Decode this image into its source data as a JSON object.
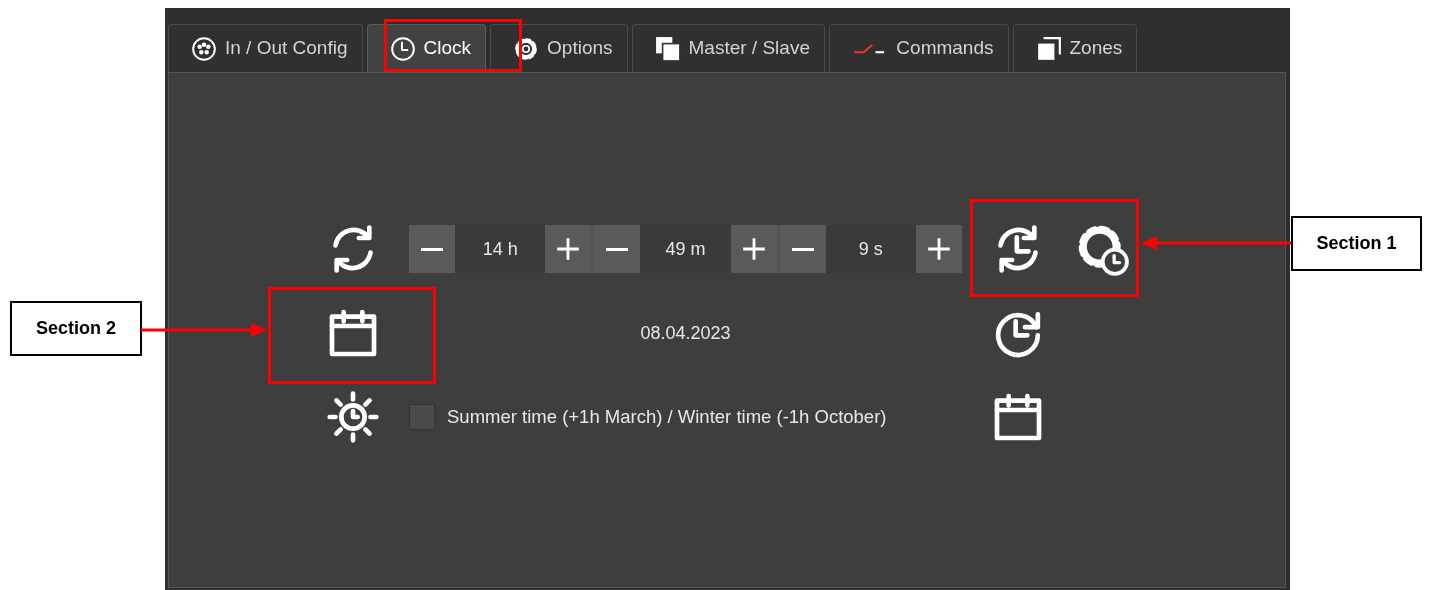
{
  "tabs": [
    {
      "label": "In / Out Config",
      "selected": false
    },
    {
      "label": "Clock",
      "selected": true
    },
    {
      "label": "Options",
      "selected": false
    },
    {
      "label": "Master / Slave",
      "selected": false
    },
    {
      "label": "Commands",
      "selected": false
    },
    {
      "label": "Zones",
      "selected": false
    }
  ],
  "time_spinners": [
    {
      "value": "14 h"
    },
    {
      "value": "49 m"
    },
    {
      "value": "9 s"
    }
  ],
  "date": "08.04.2023",
  "dst": {
    "label": "Summer time (+1h March) / Winter time (-1h October)",
    "checked": false
  },
  "callouts": [
    {
      "label": "Section 1"
    },
    {
      "label": "Section 2"
    }
  ]
}
